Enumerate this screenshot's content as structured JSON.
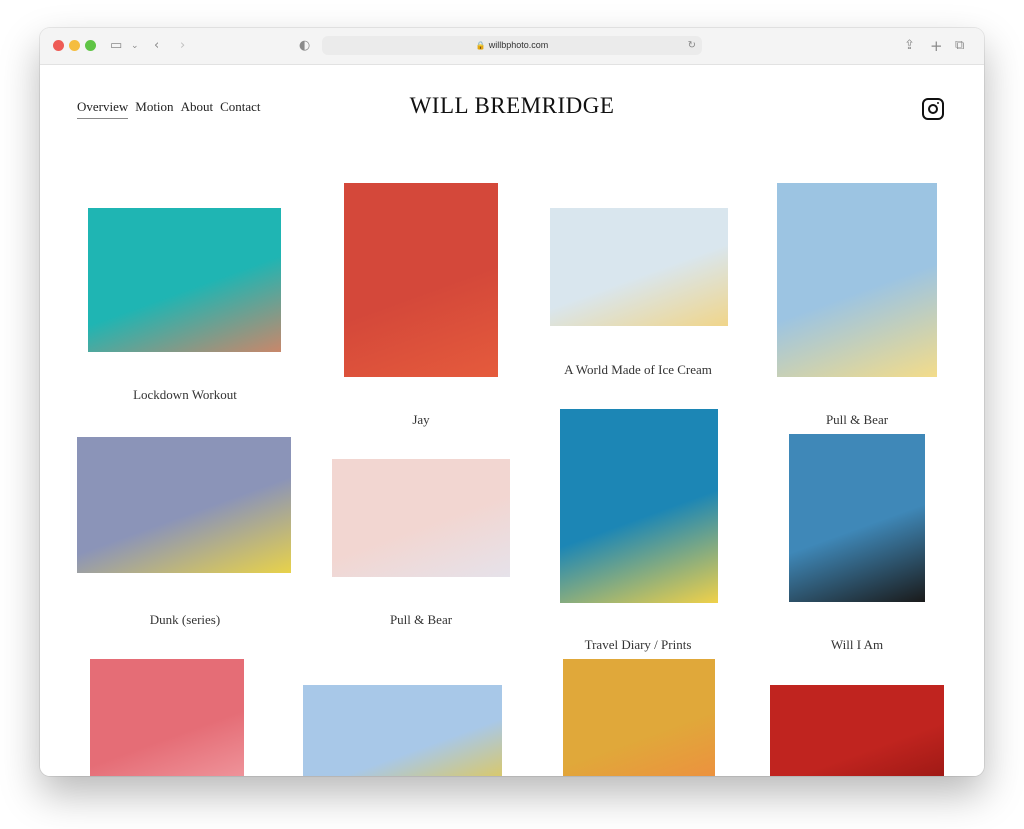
{
  "browser": {
    "url": "willbphoto.com"
  },
  "nav": {
    "items": [
      "Overview",
      "Motion",
      "About",
      "Contact"
    ],
    "active": "Overview"
  },
  "site": {
    "title": "WILL BREMRIDGE",
    "social_icon": "instagram-icon"
  },
  "gallery": [
    {
      "caption": "Lockdown Workout",
      "colors": [
        "#1fb5b3",
        "#c9876a"
      ]
    },
    {
      "caption": "Jay",
      "colors": [
        "#d4483a",
        "#e55b3c"
      ]
    },
    {
      "caption": "A World Made of Ice Cream",
      "colors": [
        "#d9e6ee",
        "#f0d58a"
      ]
    },
    {
      "caption": "Pull & Bear",
      "colors": [
        "#9cc4e2",
        "#f3dc8a"
      ]
    },
    {
      "caption": "Dunk (series)",
      "colors": [
        "#8b94b8",
        "#e8d24a"
      ]
    },
    {
      "caption": "Pull & Bear",
      "colors": [
        "#f2d6d1",
        "#e6e2ea"
      ]
    },
    {
      "caption": "Travel Diary / Prints",
      "colors": [
        "#1c86b5",
        "#f0d14a"
      ]
    },
    {
      "caption": "Will I Am",
      "colors": [
        "#3f88b8",
        "#1a1a1a"
      ]
    },
    {
      "caption": "",
      "colors": [
        "#e56d76",
        "#f2a0a6"
      ]
    },
    {
      "caption": "",
      "colors": [
        "#a8c8e8",
        "#f0c930"
      ]
    },
    {
      "caption": "",
      "colors": [
        "#e0a83a",
        "#f08a40"
      ]
    },
    {
      "caption": "",
      "colors": [
        "#c0241f",
        "#8e1410"
      ]
    }
  ]
}
